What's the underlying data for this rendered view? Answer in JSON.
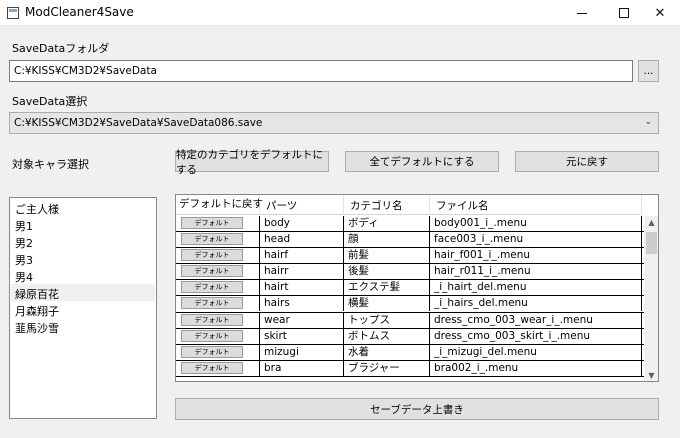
{
  "window": {
    "title": "ModCleaner4Save"
  },
  "savedata_folder": {
    "label": "SaveDataフォルダ",
    "value": "C:¥KISS¥CM3D2¥SaveData",
    "browse_label": "..."
  },
  "savedata_select": {
    "label": "SaveData選択",
    "value": "C:¥KISS¥CM3D2¥SaveData¥SaveData086.save"
  },
  "target": {
    "label": "対象キャラ選択",
    "btn_category_default": "特定のカテゴリをデフォルトにする",
    "btn_all_default": "全てデフォルトにする",
    "btn_restore": "元に戻す"
  },
  "characters": [
    "ご主人様",
    "男1",
    "男2",
    "男3",
    "男4",
    "緑原百花",
    "月森翔子",
    "韮馬沙雪"
  ],
  "selected_character": "緑原百花",
  "grid": {
    "columns": [
      "デフォルトに戻す",
      "パーツ",
      "カテゴリ名",
      "ファイル名"
    ],
    "row_button_label": "デフォルト",
    "rows": [
      [
        "body",
        "ボディ",
        "body001_i_.menu"
      ],
      [
        "head",
        "顔",
        "face003_i_.menu"
      ],
      [
        "hairf",
        "前髪",
        "hair_f001_i_.menu"
      ],
      [
        "hairr",
        "後髪",
        "hair_r011_i_.menu"
      ],
      [
        "hairt",
        "エクステ髪",
        "_i_hairt_del.menu"
      ],
      [
        "hairs",
        "横髪",
        "_i_hairs_del.menu"
      ],
      [
        "wear",
        "トップス",
        "dress_cmo_003_wear_i_.menu"
      ],
      [
        "skirt",
        "ボトムス",
        "dress_cmo_003_skirt_i_.menu"
      ],
      [
        "mizugi",
        "水着",
        "_i_mizugi_del.menu"
      ],
      [
        "bra",
        "ブラジャー",
        "bra002_i_.menu"
      ]
    ]
  },
  "save_button_label": "セーブデータ上書き"
}
